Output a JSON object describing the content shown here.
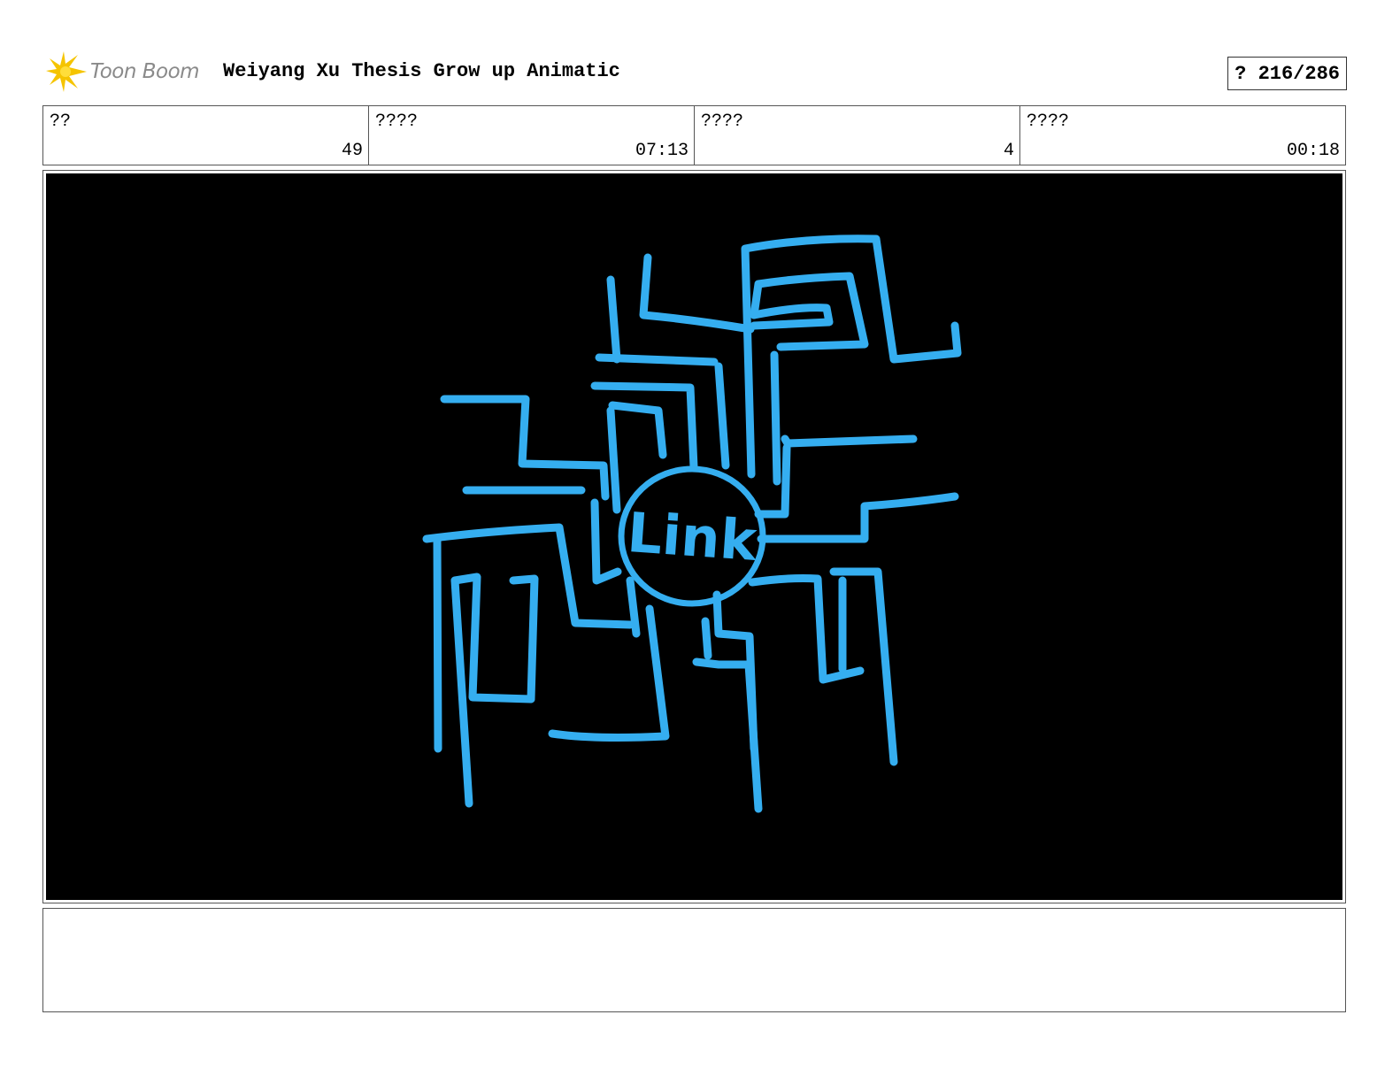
{
  "header": {
    "logo_text": "Toon Boom",
    "logo_icon": "toon-boom-burst-icon",
    "title": "Weiyang Xu Thesis Grow up Animatic",
    "page_label": "? 216/286"
  },
  "info": [
    {
      "label": "??",
      "value": "49"
    },
    {
      "label": "????",
      "value": "07:13"
    },
    {
      "label": "????",
      "value": "4"
    },
    {
      "label": "????",
      "value": "00:18"
    }
  ],
  "panel": {
    "drawing_text": "Link",
    "stroke_color": "#35aef0",
    "background": "#000000"
  },
  "notes": {
    "text": ""
  }
}
